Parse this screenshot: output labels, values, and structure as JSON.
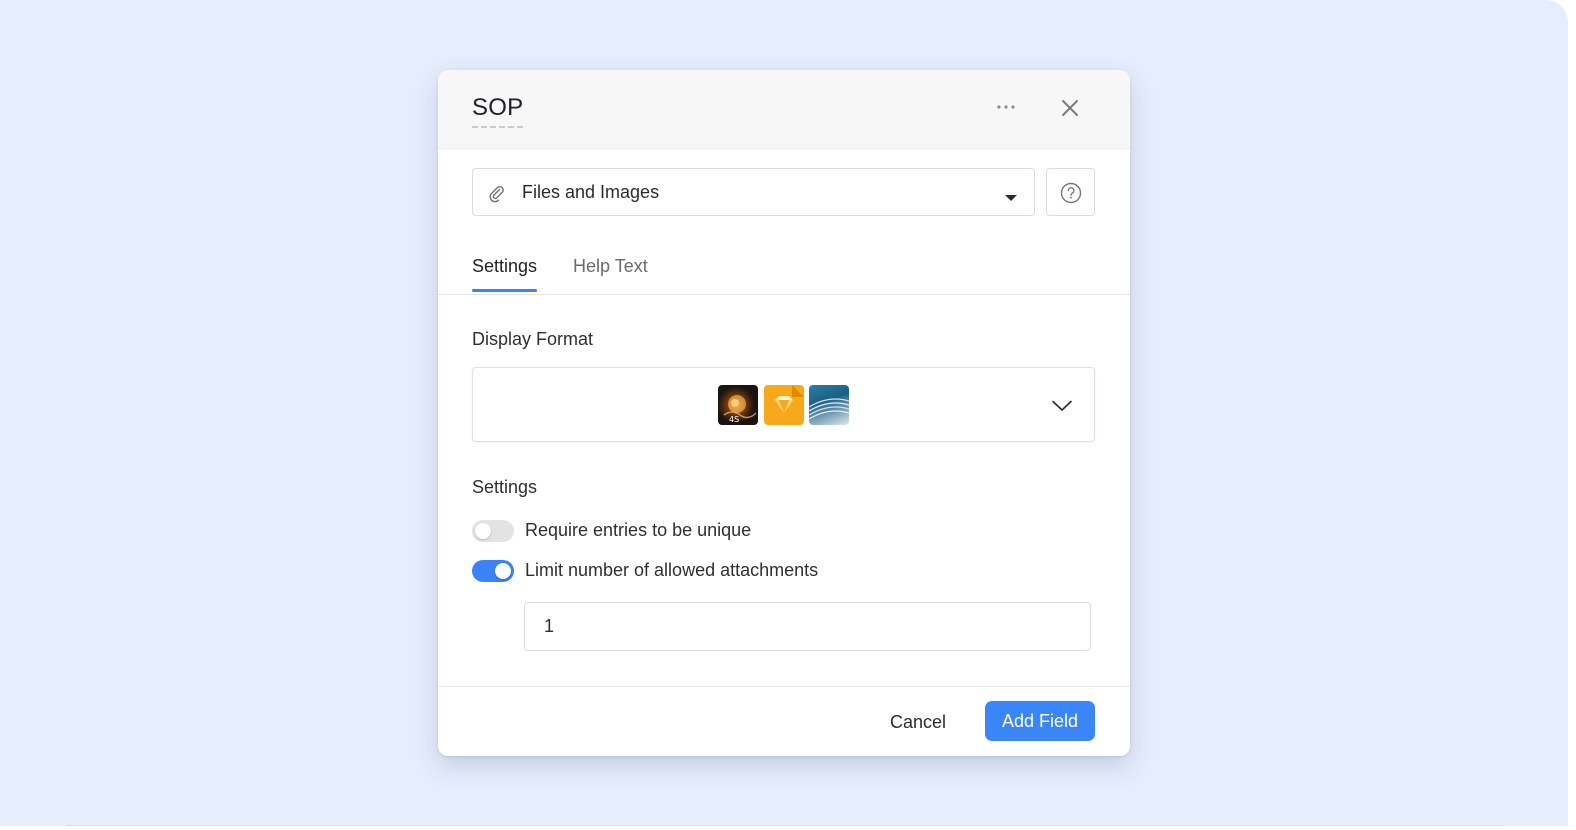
{
  "dialog": {
    "title": "SOP",
    "more_icon": "more-horizontal-icon",
    "close_icon": "close-icon"
  },
  "field_type": {
    "icon": "paperclip-icon",
    "label": "Files and Images",
    "caret_icon": "caret-down-icon",
    "help_icon": "question-circle-icon"
  },
  "tabs": [
    {
      "label": "Settings",
      "active": true
    },
    {
      "label": "Help Text",
      "active": false
    }
  ],
  "display_format": {
    "label": "Display Format",
    "preview_thumbnails": [
      "photo-thumbnail",
      "sketch-file-thumbnail",
      "wave-image-thumbnail"
    ],
    "chevron_icon": "chevron-down-icon"
  },
  "settings": {
    "label": "Settings",
    "options": [
      {
        "label": "Require entries to be unique",
        "enabled": false
      },
      {
        "label": "Limit number of allowed attachments",
        "enabled": true
      }
    ],
    "limit_value": "1"
  },
  "footer": {
    "cancel_label": "Cancel",
    "add_label": "Add Field"
  },
  "colors": {
    "accent": "#3b82f6",
    "background": "#e6eefd"
  }
}
